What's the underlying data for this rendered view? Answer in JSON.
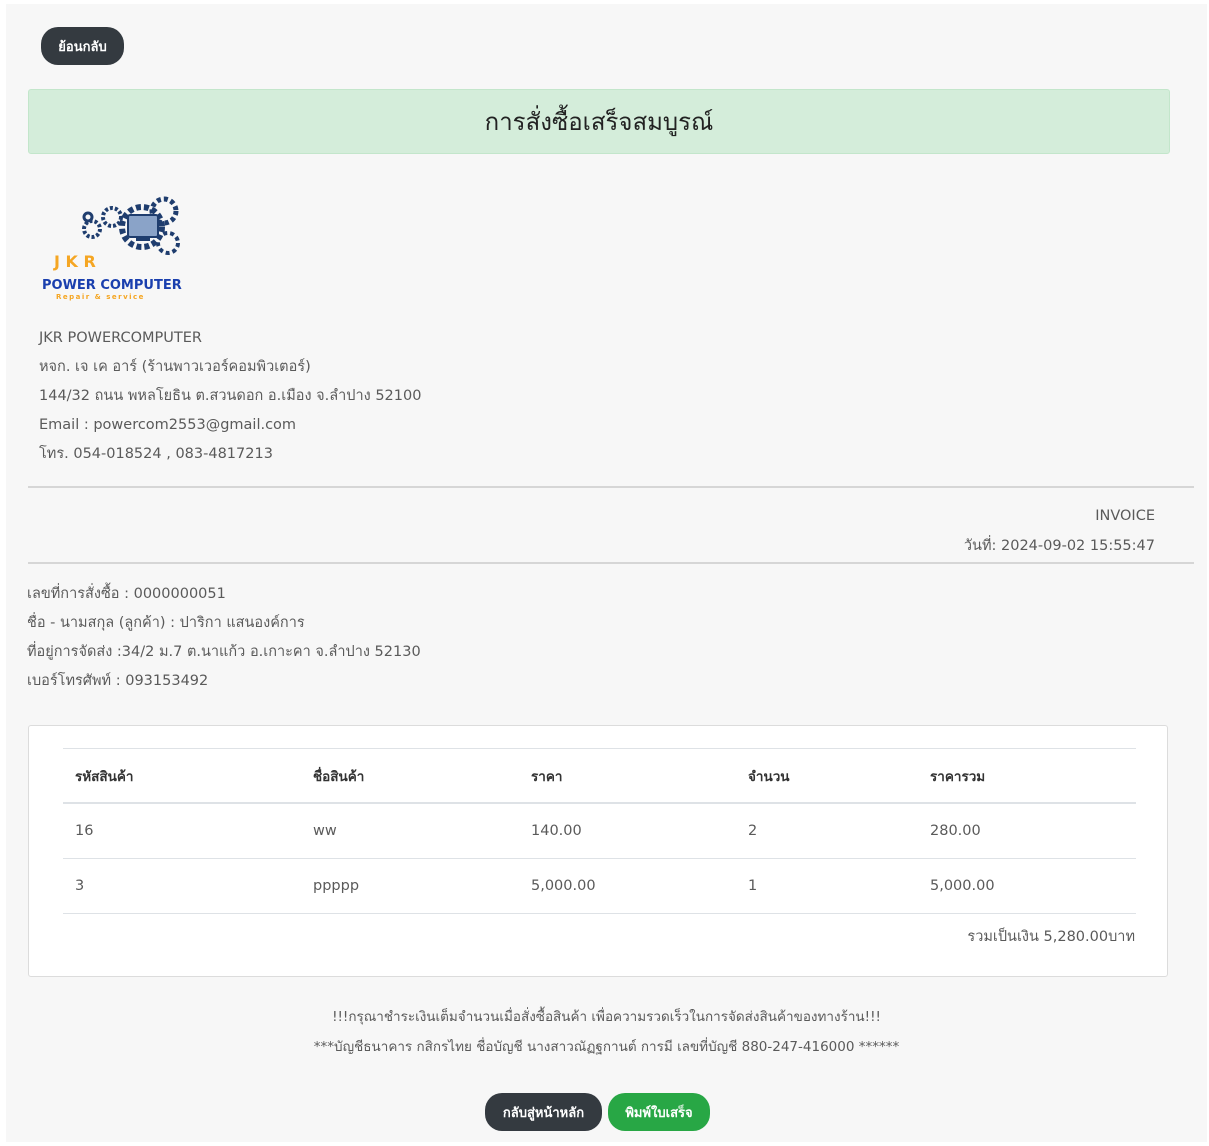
{
  "nav": {
    "back_label": "ย้อนกลับ"
  },
  "banner": {
    "message": "การสั่งซื้อเสร็จสมบูรณ์"
  },
  "shop": {
    "logo": {
      "letters": "J K R",
      "name": "POWER COMPUTER",
      "tagline": "Repair & service"
    },
    "name": "JKR POWERCOMPUTER",
    "legal_name": "หจก. เจ เค อาร์ (ร้านพาวเวอร์คอมพิวเตอร์)",
    "address": "144/32 ถนน พหลโยธิน ต.สวนดอก อ.เมือง จ.ลำปาง 52100",
    "email": "Email : powercom2553@gmail.com",
    "phone": "โทร. 054-018524 , 083-4817213"
  },
  "invoice": {
    "title": "INVOICE",
    "date": "วันที่: 2024-09-02 15:55:47"
  },
  "customer": {
    "order_no": "เลขที่การสั่งซื้อ : 0000000051",
    "name": "ชื่อ - นามสกุล (ลูกค้า) : ปาริกา แสนองค์การ",
    "address": "ที่อยู่การจัดส่ง :34/2 ม.7 ต.นาแก้ว อ.เกาะคา จ.ลำปาง 52130",
    "phone": "เบอร์โทรศัพท์ : 093153492"
  },
  "table": {
    "headers": [
      "รหัสสินค้า",
      "ชื่อสินค้า",
      "ราคา",
      "จำนวน",
      "ราคารวม"
    ],
    "rows": [
      [
        "16",
        "ww",
        "140.00",
        "2",
        "280.00"
      ],
      [
        "3",
        "ppppp",
        "5,000.00",
        "1",
        "5,000.00"
      ]
    ],
    "total": "รวมเป็นเงิน 5,280.00บาท"
  },
  "notes": {
    "payment_notice": "!!!กรุณาชำระเงินเต็มจำนวนเมื่อสั่งซื้อสินค้า เพื่อความรวดเร็วในการจัดส่งสินค้าของทางร้าน!!!",
    "bank_info": "***บัญชีธนาคาร กสิกรไทย ชื่อบัญชี นางสาวณัฏฐกานต์ การมี เลขที่บัญชี 880-247-416000 ******"
  },
  "actions": {
    "home_label": "กลับสู่หน้าหลัก",
    "print_label": "พิมพ์ใบเสร็จ"
  },
  "colors": {
    "dark_button": "#343a40",
    "green_button": "#28a745",
    "success_bg": "#d4edda",
    "logo_blue": "#1a3fae",
    "logo_orange": "#f5a623"
  }
}
